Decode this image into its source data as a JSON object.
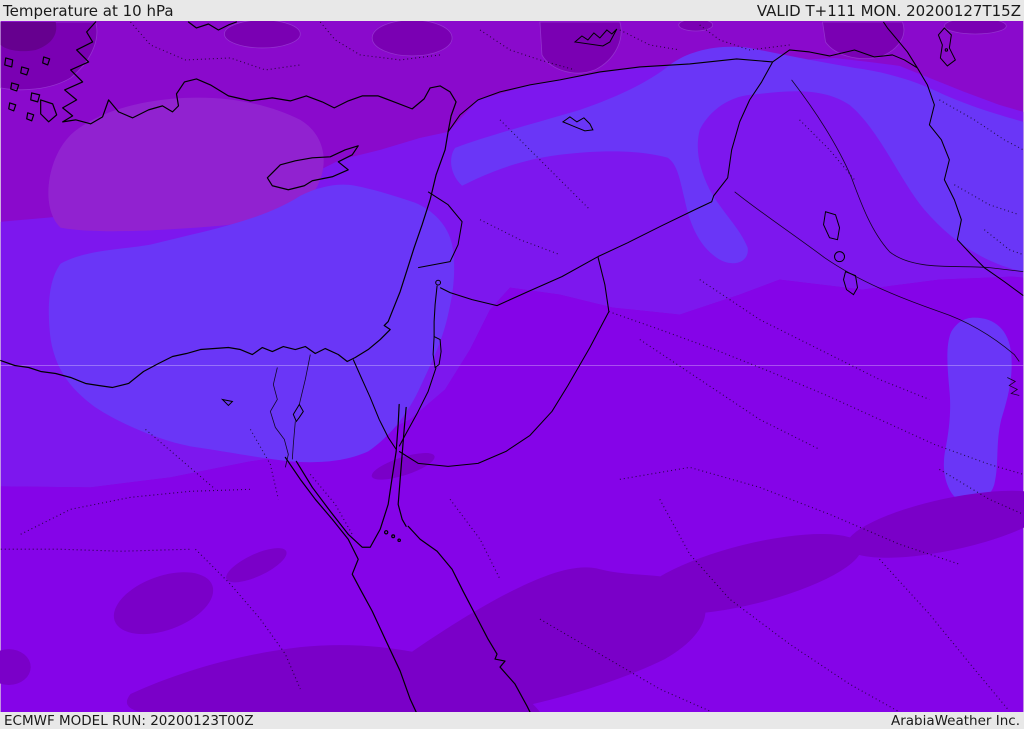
{
  "header": {
    "title": "Temperature at 10 hPa",
    "valid_label": "VALID T+111 MON. 20200127T15Z"
  },
  "footer": {
    "model_run_label": "ECMWF MODEL RUN: 20200123T00Z",
    "brand_label": "ArabiaWeather Inc."
  },
  "map": {
    "palette": {
      "band_top_purple": "#8a0acc",
      "band_top_dark": "#7a00b3",
      "band_top_darkest": "#66008f",
      "band_light_patch": "#9122d0",
      "band_violet": "#7d17ee",
      "band_blue": "#6a36f7",
      "band_bottom_purple": "#8504e8",
      "band_bottom_dark": "#7a00c8",
      "line_coast": "#000000",
      "graticule": "rgba(255,255,255,0.3)",
      "chrome_bg": "#e8e8e8",
      "chrome_text": "#1a1a1a"
    }
  }
}
